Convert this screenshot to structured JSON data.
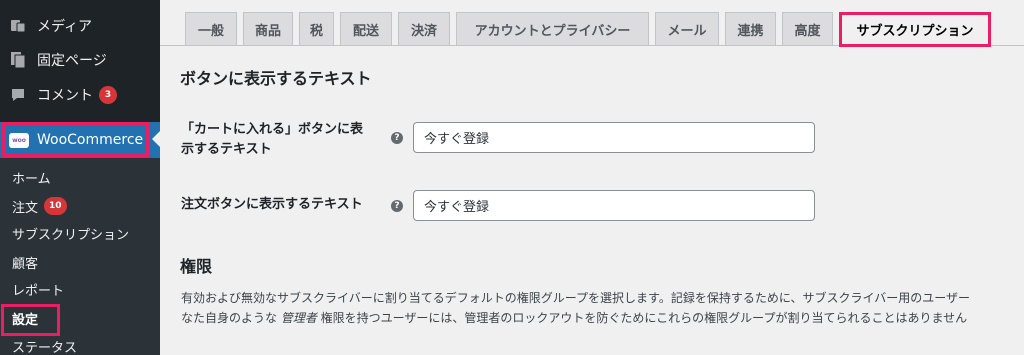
{
  "sidebar": {
    "items": [
      {
        "label": "メディア",
        "icon": "media-icon"
      },
      {
        "label": "固定ページ",
        "icon": "pages-icon"
      },
      {
        "label": "コメント",
        "icon": "comments-icon",
        "badge": "3"
      }
    ],
    "woocommerce": {
      "label": "WooCommerce",
      "logo_text": "woo"
    },
    "submenu": [
      {
        "label": "ホーム"
      },
      {
        "label": "注文",
        "badge": "10"
      },
      {
        "label": "サブスクリプション"
      },
      {
        "label": "顧客"
      },
      {
        "label": "レポート"
      },
      {
        "label": "設定"
      },
      {
        "label": "ステータス"
      }
    ]
  },
  "tabs": [
    "一般",
    "商品",
    "税",
    "配送",
    "決済",
    "アカウントとプライバシー",
    "メール",
    "連携",
    "高度",
    "サブスクリプション"
  ],
  "active_tab": "サブスクリプション",
  "section_button_text": {
    "heading": "ボタンに表示するテキスト",
    "fields": [
      {
        "label_line1": "「カートに入れる」ボタンに表",
        "label_line2": "示するテキスト",
        "value": "今すぐ登録"
      },
      {
        "label": "注文ボタンに表示するテキスト",
        "value": "今すぐ登録"
      }
    ]
  },
  "section_permissions": {
    "heading": "権限",
    "desc_line1": "有効および無効なサブスクライバーに割り当てるデフォルトの権限グループを選択します。記録を保持するために、サブスクライバー用のユーザー",
    "desc_line2_a": "なた自身のような ",
    "desc_line2_em": "管理者",
    "desc_line2_b": " 権限を持つユーザーには、管理者のロックアウトを防ぐためにこれらの権限グループが割り当てられることはありません"
  },
  "help_glyph": "?",
  "colors": {
    "sidebar_bg": "#1d2327",
    "submenu_bg": "#2c3338",
    "active_menu": "#2271b1",
    "highlight": "#e91e63",
    "badge": "#d63638"
  }
}
